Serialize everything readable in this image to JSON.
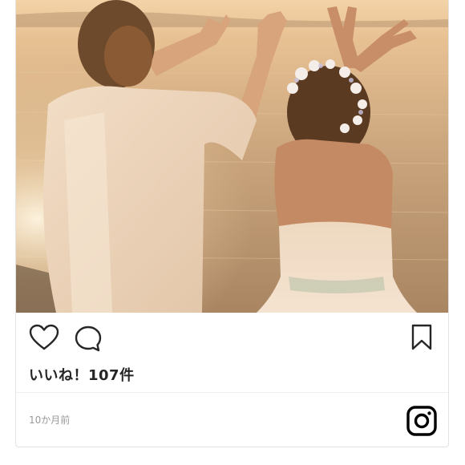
{
  "post": {
    "likes_text": "いいね！107件",
    "timestamp": "10か月前"
  },
  "icons": {
    "like": "heart-outline-icon",
    "comment": "speech-bubble-icon",
    "save": "bookmark-icon",
    "brand": "instagram-logo-icon"
  },
  "colors": {
    "icon": "#262626",
    "likes_text": "#262626",
    "timestamp": "#999999",
    "border": "#e3e3e3"
  }
}
